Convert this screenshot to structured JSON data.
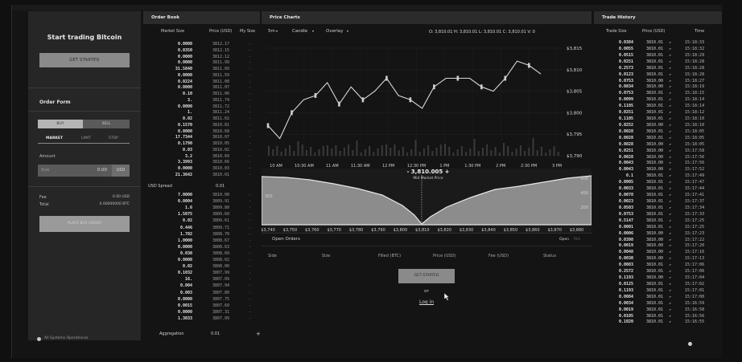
{
  "left_panel": {
    "title": "Start trading Bitcoin",
    "get_started": "GET STARTED",
    "order_form_title": "Order Form",
    "buy": "BUY",
    "sell": "SELL",
    "order_types": [
      "MARKET",
      "LIMIT",
      "STOP"
    ],
    "amount_label": "Amount",
    "amount_placeholder": "Size",
    "amount_value": "0.00",
    "amount_unit": "USD",
    "fee_label": "Fee",
    "fee_value": "0.00 USD",
    "total_label": "Total",
    "total_value": "0.00000000 BTC",
    "place_order": "PLACE BUY ORDER",
    "status": "All Systems Operational"
  },
  "order_book": {
    "title": "Order Book",
    "headers": [
      "Market Size",
      "Price (USD)",
      "My Size"
    ],
    "asks": [
      [
        "0.0000",
        "3812.17"
      ],
      [
        "0.0350",
        "3812.15"
      ],
      [
        "0.0000",
        "3812.12"
      ],
      [
        "0.0000",
        "3811.99"
      ],
      [
        "31.5840",
        "3811.60"
      ],
      [
        "0.0000",
        "3811.59"
      ],
      [
        "0.0224",
        "3811.08"
      ],
      [
        "0.0000",
        "3811.07"
      ],
      [
        "0.10",
        "3811.06"
      ],
      [
        "3.",
        "3811.74"
      ],
      [
        "0.0000",
        "3811.72"
      ],
      [
        "1.",
        "3811.24"
      ],
      [
        "0.02",
        "3811.02"
      ],
      [
        "0.1570",
        "3810.81"
      ],
      [
        "0.0000",
        "3810.68"
      ],
      [
        "17.7344",
        "3810.07"
      ],
      [
        "0.1790",
        "3810.05"
      ],
      [
        "0.03",
        "3810.02"
      ],
      [
        "3.2",
        "3810.69"
      ],
      [
        "3.3993",
        "3810.66"
      ],
      [
        "0.0000",
        "3810.03"
      ],
      [
        "21.3642",
        "3810.01"
      ]
    ],
    "spread_label": "USD Spread",
    "spread_value": "0.01",
    "bids": [
      [
        "7.0000",
        "3810.00"
      ],
      [
        "0.0004",
        "3809.91"
      ],
      [
        "1.6",
        "3809.80"
      ],
      [
        "1.5075",
        "3809.60"
      ],
      [
        "0.02",
        "3809.61"
      ],
      [
        "0.446",
        "3809.71"
      ],
      [
        "1.702",
        "3808.70"
      ],
      [
        "1.0000",
        "3808.67"
      ],
      [
        "0.0000",
        "3808.63"
      ],
      [
        "0.030",
        "3808.60"
      ],
      [
        "0.0000",
        "3808.02"
      ],
      [
        "0.02",
        "3808.00"
      ],
      [
        "0.1032",
        "3807.99"
      ],
      [
        "16.",
        "3807.09"
      ],
      [
        "0.004",
        "3807.94"
      ],
      [
        "0.003",
        "3807.80"
      ],
      [
        "0.0000",
        "3807.75"
      ],
      [
        "0.0015",
        "3807.60"
      ],
      [
        "0.0000",
        "3807.31"
      ],
      [
        "1.3033",
        "3807.09"
      ]
    ],
    "aggregation_label": "Aggregation",
    "aggregation_value": "0.01",
    "aggregation_plus": "+",
    "my_size_mark": "-"
  },
  "price_chart": {
    "title": "Price Charts",
    "interval": "5m",
    "style": "Candle",
    "overlay": "Overlay",
    "ohlc": "O: 3,810.01  H: 3,810.01  L: 3,810.01  C: 3,810.01  V: 0",
    "mid_price": "- 3,810.005 +",
    "mid_label": "Mid Market Price",
    "depth_left_ticks": [
      "300"
    ],
    "open_orders_title": "Open Orders",
    "open_orders_tabs": [
      "Open",
      "Fills"
    ],
    "columns": [
      "Side",
      "Size",
      "Filled (BTC)",
      "Price (USD)",
      "Fee (USD)",
      "Status"
    ],
    "get_started": "GET STARTED",
    "or": "or",
    "login": "Log in"
  },
  "trade_history": {
    "title": "Trade History",
    "headers": [
      "Trade Size",
      "Price (USD)",
      "Time"
    ],
    "rows": [
      [
        "0.0384",
        "3810.01",
        "15:18:33"
      ],
      [
        "0.0055",
        "3810.01",
        "15:18:32"
      ],
      [
        "0.0515",
        "3810.01",
        "15:18:29"
      ],
      [
        "0.0251",
        "3810.01",
        "15:18:28"
      ],
      [
        "0.2573",
        "3810.01",
        "15:18:28"
      ],
      [
        "0.0123",
        "3810.01",
        "15:18:28"
      ],
      [
        "0.0753",
        "3810.00",
        "15:18:27"
      ],
      [
        "0.0834",
        "3810.00",
        "15:18:19"
      ],
      [
        "0.0753",
        "3810.01",
        "15:18:15"
      ],
      [
        "0.0099",
        "3810.01",
        "15:18:14"
      ],
      [
        "0.1105",
        "3810.01",
        "15:18:14"
      ],
      [
        "0.0251",
        "3810.01",
        "15:18:12"
      ],
      [
        "0.1105",
        "3810.01",
        "15:18:10"
      ],
      [
        "0.0252",
        "3810.00",
        "15:18:10"
      ],
      [
        "0.0028",
        "3810.01",
        "15:18:05"
      ],
      [
        "0.0028",
        "3810.01",
        "15:18:05"
      ],
      [
        "0.0828",
        "3810.00",
        "15:18:05"
      ],
      [
        "0.0251",
        "3810.00",
        "15:17:58"
      ],
      [
        "0.0028",
        "3810.00",
        "15:17:56"
      ],
      [
        "0.0043",
        "3810.00",
        "15:17:56"
      ],
      [
        "0.0043",
        "3810.00",
        "15:17:52"
      ],
      [
        "0.1",
        "3810.01",
        "15:17:49"
      ],
      [
        "0.0005",
        "3810.01",
        "15:17:47"
      ],
      [
        "0.0033",
        "3810.01",
        "15:17:44"
      ],
      [
        "0.0078",
        "3810.01",
        "15:17:41"
      ],
      [
        "0.0023",
        "3810.01",
        "15:17:37"
      ],
      [
        "0.0503",
        "3810.01",
        "15:17:34"
      ],
      [
        "0.0753",
        "3810.01",
        "15:17:33"
      ],
      [
        "0.5147",
        "3810.01",
        "15:17:25"
      ],
      [
        "0.0001",
        "3810.01",
        "15:17:25"
      ],
      [
        "0.0006",
        "3810.00",
        "15:17:23"
      ],
      [
        "0.0398",
        "3810.00",
        "15:17:22"
      ],
      [
        "0.0019",
        "3810.00",
        "15:17:20"
      ],
      [
        "0.0048",
        "3810.00",
        "15:17:16"
      ],
      [
        "0.0030",
        "3810.00",
        "15:17:13"
      ],
      [
        "0.0083",
        "3810.01",
        "15:17:06"
      ],
      [
        "0.2572",
        "3810.01",
        "15:17:06"
      ],
      [
        "0.1193",
        "3810.00",
        "15:17:04"
      ],
      [
        "0.0125",
        "3810.01",
        "15:17:02"
      ],
      [
        "0.1193",
        "3810.01",
        "15:17:01"
      ],
      [
        "0.0084",
        "3810.01",
        "15:17:00"
      ],
      [
        "0.0034",
        "3810.01",
        "15:16:59"
      ],
      [
        "0.0019",
        "3810.01",
        "15:16:58"
      ],
      [
        "0.0105",
        "3810.01",
        "15:16:56"
      ],
      [
        "0.1020",
        "3810.01",
        "15:16:55"
      ]
    ]
  },
  "chart_data": {
    "type": "line",
    "description_note": "",
    "x": [
      "10 AM",
      "10:30 AM",
      "11 AM",
      "11:30 AM",
      "12 PM",
      "12:30 PM",
      "1 PM",
      "1:30 PM",
      "2 PM",
      "2:30 PM",
      "3 PM"
    ],
    "series": [
      {
        "values": [
          3797,
          3794,
          3800,
          3803,
          3804,
          3807,
          3802,
          3806,
          3803,
          3805,
          3808,
          3804,
          3803,
          3801,
          3806,
          3808,
          3808,
          3808,
          3806,
          3805,
          3808,
          3812,
          3811,
          3809
        ]
      }
    ],
    "ylabels": [
      "$3,815",
      "$3,810",
      "$3,805",
      "$3,800",
      "$3,795",
      "$3,790"
    ],
    "ylim": [
      3790,
      3815
    ],
    "depth_x": [
      "$3,740",
      "$3,750",
      "$3,760",
      "$3,770",
      "$3,780",
      "$3,790",
      "$3,800",
      "$3,810",
      "$3,820",
      "$3,830",
      "$3,840",
      "$3,850",
      "$3,860",
      "$3,870",
      "$3,880"
    ],
    "depth_y": [
      "600",
      "400",
      "200"
    ]
  }
}
